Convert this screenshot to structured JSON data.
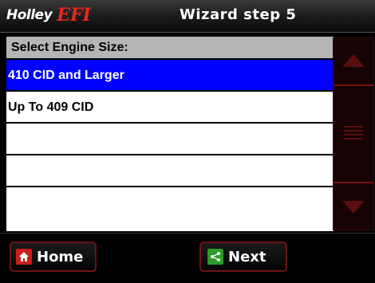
{
  "header": {
    "logo_primary": "Holley",
    "logo_secondary": "EFI",
    "title": "Wizard step 5"
  },
  "list": {
    "heading": "Select Engine Size:",
    "items": [
      {
        "label": "410 CID and Larger",
        "selected": true
      },
      {
        "label": "Up To 409 CID",
        "selected": false
      },
      {
        "label": "",
        "selected": false
      },
      {
        "label": "",
        "selected": false
      },
      {
        "label": "",
        "selected": false
      }
    ]
  },
  "footer": {
    "home_label": "Home",
    "next_label": "Next"
  },
  "colors": {
    "selection": "#0000ff",
    "accent_red": "#c8201a",
    "next_green": "#2a9a2a",
    "scroll_red": "#7a1010"
  },
  "icons": {
    "home": "home-icon",
    "next": "share-icon",
    "scroll_up": "arrow-up-icon",
    "scroll_down": "arrow-down-icon",
    "thumb": "grip-icon"
  }
}
